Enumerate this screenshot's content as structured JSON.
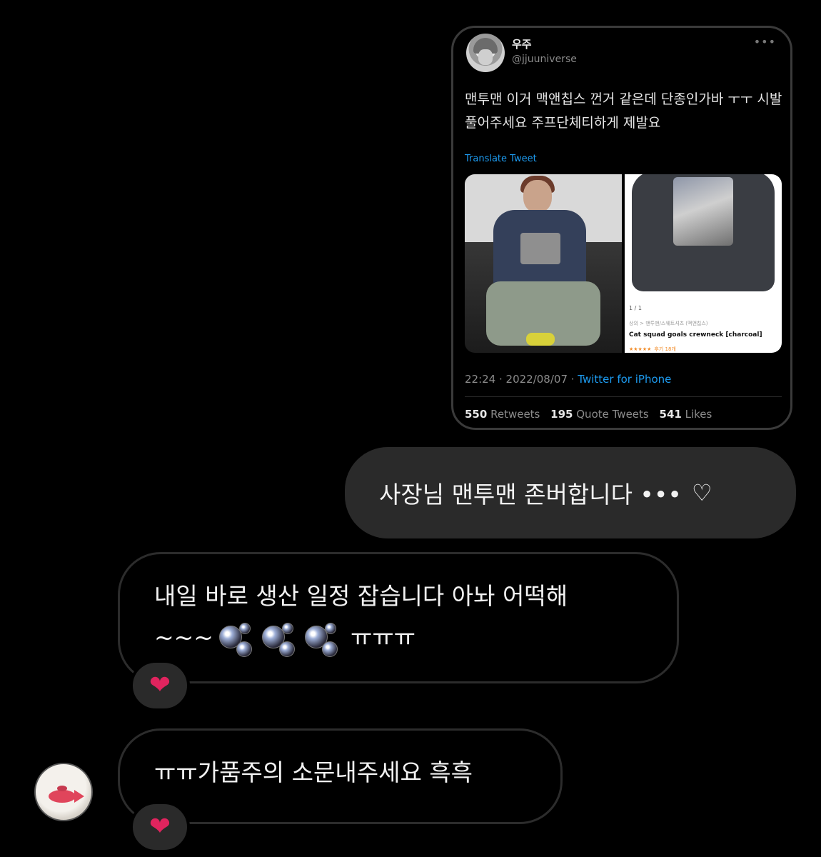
{
  "tweet": {
    "name": "우주",
    "handle": "@jjuuniverse",
    "more": "•••",
    "text": "맨투맨 이거 맥앤칩스 껀거 같은데 단종인가바 ㅜㅜ 시발 풀어주세요 주프단체티하게 제발요",
    "translate_label": "Translate Tweet",
    "product": {
      "pager": "1 / 1",
      "category": "상의 > 맨투맨/스웨트셔츠 (맥앤칩스)",
      "name": "Cat squad goals crewneck [charcoal]",
      "stars": "★★★★★",
      "reviews": "후기 18개"
    },
    "time": "22:24 · 2022/08/07 · ",
    "source": "Twitter for iPhone",
    "retweets_count": "550",
    "retweets_label": "Retweets",
    "quotes_count": "195",
    "quotes_label": "Quote Tweets",
    "likes_count": "541",
    "likes_label": "Likes"
  },
  "messages": {
    "outgoing": {
      "text": "사장님 맨투맨 존버합니다 •••",
      "heart": "♡"
    },
    "incoming_1": {
      "line1": "내일 바로 생산 일정 잡습니다 아놔 어떡해",
      "line2_prefix": "~~~",
      "line2_suffix": "ㅠㅠㅠ",
      "reaction": "❤"
    },
    "incoming_2": {
      "text": "ㅠㅠ가품주의 소문내주세요 흑흑",
      "reaction": "❤"
    }
  },
  "icons": {
    "reaction": "heart-icon",
    "bubbles": "bubbles-icon",
    "avatar": "goldfish-avatar"
  },
  "colors": {
    "background": "#000000",
    "outgoing_bubble": "#2a2a2a",
    "link": "#1d9bf0",
    "reaction_heart": "#e0245e"
  }
}
